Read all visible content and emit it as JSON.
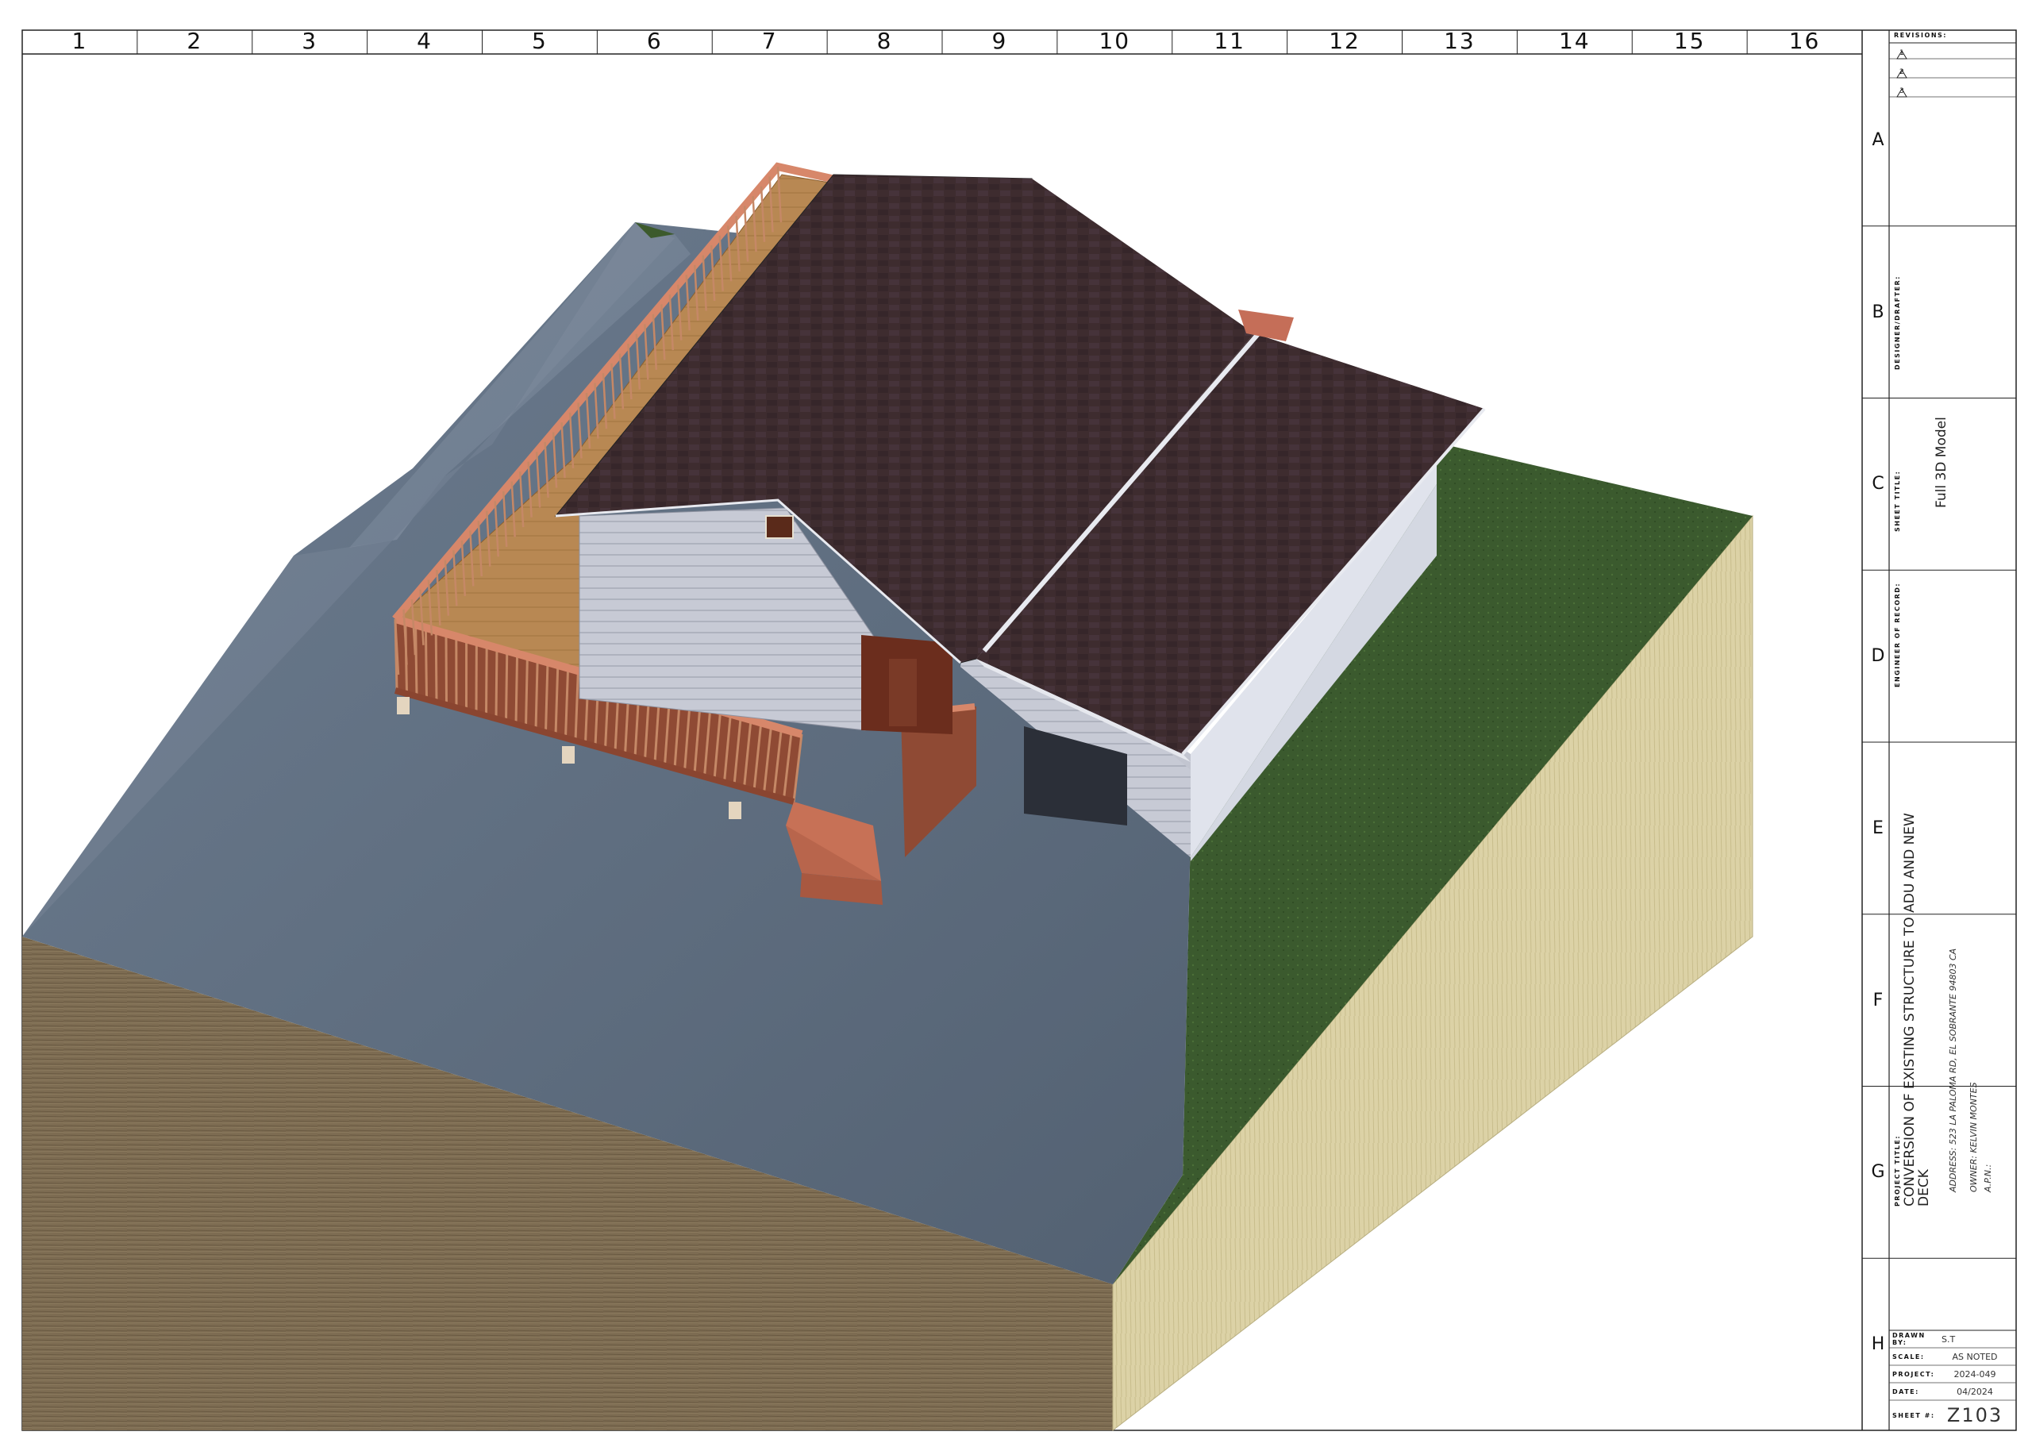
{
  "columns": [
    "1",
    "2",
    "3",
    "4",
    "5",
    "6",
    "7",
    "8",
    "9",
    "10",
    "11",
    "12",
    "13",
    "14",
    "15",
    "16"
  ],
  "rows": [
    "A",
    "B",
    "C",
    "D",
    "E",
    "F",
    "G",
    "H"
  ],
  "title_block": {
    "revisions_label": "REVISIONS:",
    "revision_numbers": [
      "1",
      "2",
      "3"
    ],
    "designer_label": "DESIGNER/DRAFTER:",
    "sheet_title_label": "SHEET TITLE:",
    "sheet_title": "Full 3D Model",
    "engineer_label": "ENGINEER OF RECORD:",
    "project_title_label": "PROJECT TITLE:",
    "project_title_line1": "CONVERSION OF EXISTING STRUCTURE TO ADU  AND  NEW",
    "project_title_line2": "DECK",
    "address_line": "ADDRESS:  523 LA PALOMA RD, EL SOBRANTE 94803 CA",
    "owner_line": "OWNER:     KELVIN MONTES",
    "apn_line": "A.P.N.:",
    "drawn_by_label": "DRAWN BY:",
    "drawn_by": "S.T",
    "scale_label": "SCALE:",
    "scale": "AS NOTED",
    "project_label": "PROJECT:",
    "project": "2024-049",
    "date_label": "DATE:",
    "date": "04/2024",
    "sheet_no_label": "SHEET #:",
    "sheet_no": "Z103"
  },
  "colors": {
    "pavement": "#5f6f82",
    "grass": "#3a5a2c",
    "soil_front": "#7a6a50",
    "soil_side": "#d9cfa2",
    "roof": "#3f2d30",
    "siding": "#c9ccd6",
    "deck": "#b98a54",
    "railing": "#a55740"
  }
}
